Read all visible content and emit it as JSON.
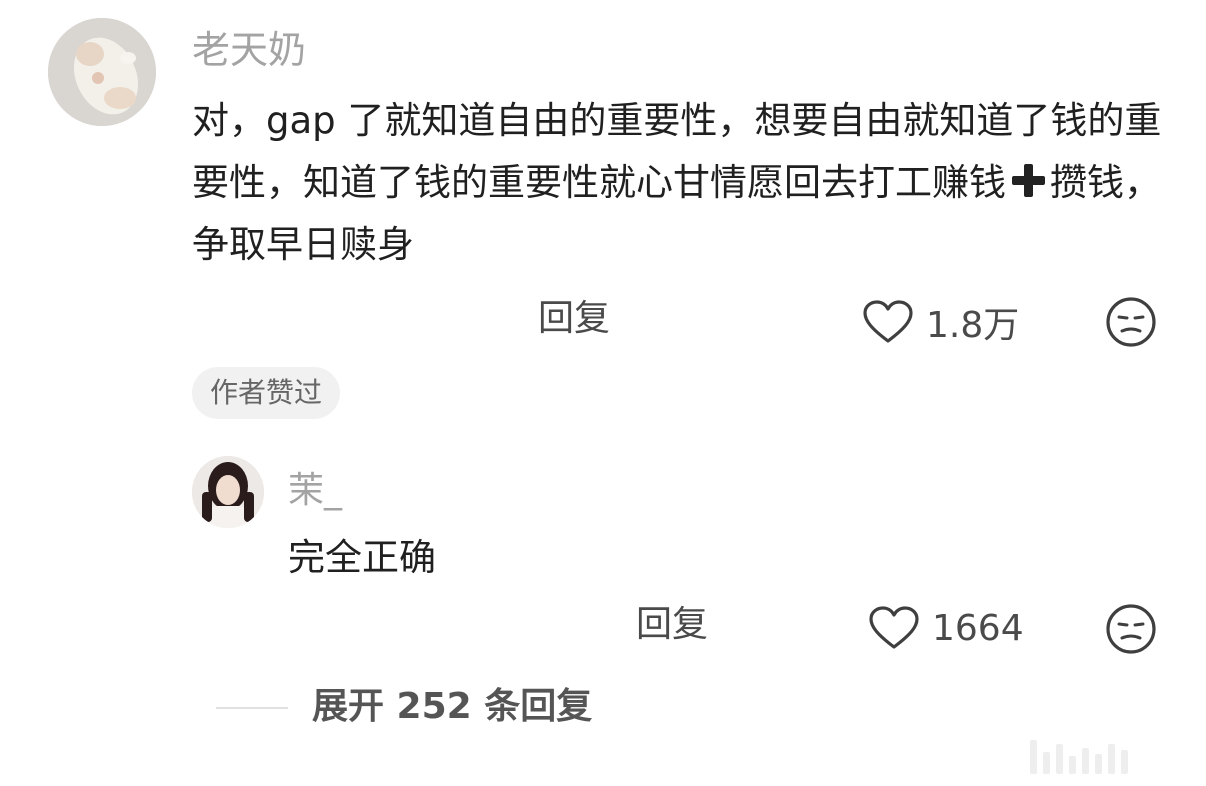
{
  "comment": {
    "username": "老天奶",
    "text_before_plus": "对，gap 了就知道自由的重要性，想要自由就知道了钱的重要性，知道了钱的重要性就心甘情愿回去打工赚钱",
    "plus_icon": "heavy-plus-emoji",
    "text_after_plus": "攒钱，争取早日赎身",
    "reply_label": "回复",
    "like_count": "1.8万",
    "badge": "作者赞过"
  },
  "sub_comment": {
    "username": "茉_",
    "text": "完全正确",
    "reply_label": "回复",
    "like_count": "1664"
  },
  "expand": {
    "label": "展开 252 条回复"
  },
  "icons": {
    "like": "heart-outline-icon",
    "emoji": "sleepy-face-icon"
  },
  "colors": {
    "username": "#a3a3a3",
    "text": "#202020",
    "meta": "#4a4a4a",
    "badge_bg": "#f1f1f1"
  }
}
